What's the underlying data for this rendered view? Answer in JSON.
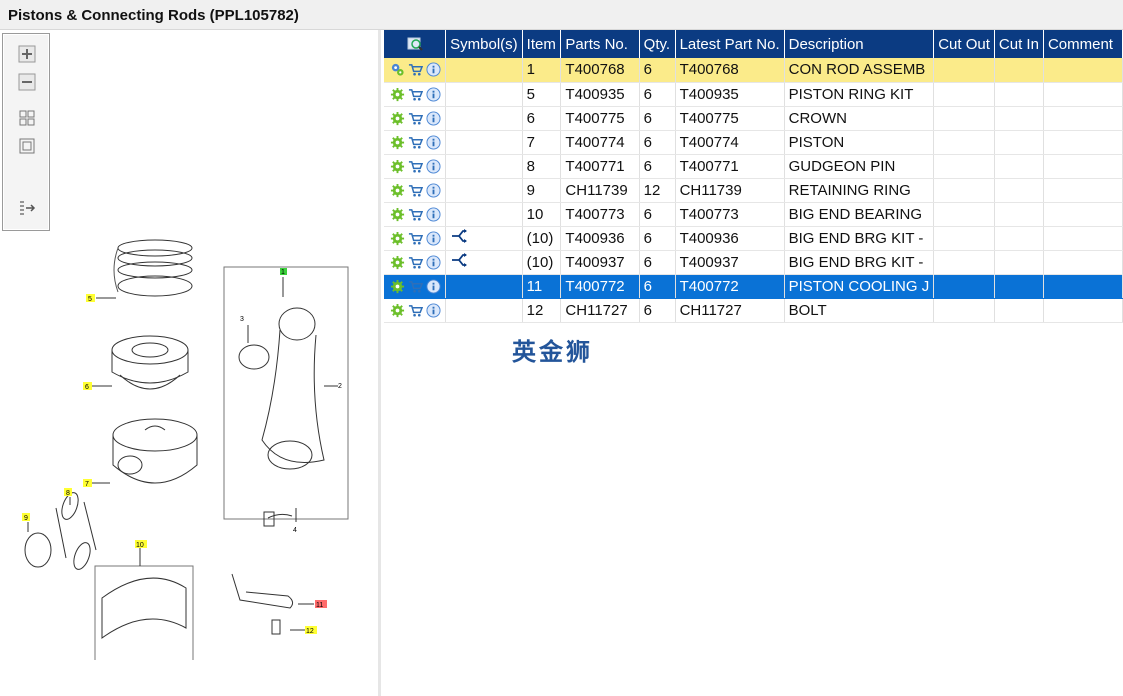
{
  "window": {
    "title": "Pistons & Connecting Rods (PPL105782)"
  },
  "toolbar": {
    "items": [
      {
        "icon": "zoom-in-icon"
      },
      {
        "icon": "zoom-out-icon"
      },
      {
        "icon": "fit-all-icon"
      },
      {
        "icon": "actual-size-icon"
      },
      {
        "icon": "toggle-list-icon"
      }
    ]
  },
  "diagram": {
    "callouts": [
      "1",
      "2",
      "3",
      "4",
      "5",
      "6",
      "7",
      "8",
      "9",
      "10",
      "11",
      "12"
    ]
  },
  "table": {
    "headers": [
      "Symbol(s)",
      "Item",
      "Parts No.",
      "Qty.",
      "Latest Part No.",
      "Description",
      "Cut Out",
      "Cut In",
      "Comment"
    ],
    "rows": [
      {
        "item": "1",
        "parts_no": "T400768",
        "qty": "6",
        "latest": "T400768",
        "desc": "CON ROD ASSEMB",
        "symbol": "",
        "state": "highlight"
      },
      {
        "item": "5",
        "parts_no": "T400935",
        "qty": "6",
        "latest": "T400935",
        "desc": "PISTON RING KIT",
        "symbol": "",
        "state": ""
      },
      {
        "item": "6",
        "parts_no": "T400775",
        "qty": "6",
        "latest": "T400775",
        "desc": "CROWN",
        "symbol": "",
        "state": ""
      },
      {
        "item": "7",
        "parts_no": "T400774",
        "qty": "6",
        "latest": "T400774",
        "desc": "PISTON",
        "symbol": "",
        "state": ""
      },
      {
        "item": "8",
        "parts_no": "T400771",
        "qty": "6",
        "latest": "T400771",
        "desc": "GUDGEON PIN",
        "symbol": "",
        "state": ""
      },
      {
        "item": "9",
        "parts_no": "CH11739",
        "qty": "12",
        "latest": "CH11739",
        "desc": "RETAINING RING",
        "symbol": "",
        "state": ""
      },
      {
        "item": "10",
        "parts_no": "T400773",
        "qty": "6",
        "latest": "T400773",
        "desc": "BIG END BEARING",
        "symbol": "",
        "state": ""
      },
      {
        "item": "(10)",
        "parts_no": "T400936",
        "qty": "6",
        "latest": "T400936",
        "desc": "BIG END BRG KIT -",
        "symbol": "alternative-icon",
        "state": ""
      },
      {
        "item": "(10)",
        "parts_no": "T400937",
        "qty": "6",
        "latest": "T400937",
        "desc": "BIG END BRG KIT -",
        "symbol": "alternative-icon",
        "state": ""
      },
      {
        "item": "11",
        "parts_no": "T400772",
        "qty": "6",
        "latest": "T400772",
        "desc": "PISTON COOLING J",
        "symbol": "",
        "state": "selected"
      },
      {
        "item": "12",
        "parts_no": "CH11727",
        "qty": "6",
        "latest": "CH11727",
        "desc": "BOLT",
        "symbol": "",
        "state": ""
      }
    ]
  },
  "watermark": "英金狮",
  "colors": {
    "header": "#0b3b82",
    "highlight": "#fbeb8a",
    "selected": "#0a72d6",
    "callout": "#ffff33",
    "callout_selected": "#ff6b6b"
  }
}
